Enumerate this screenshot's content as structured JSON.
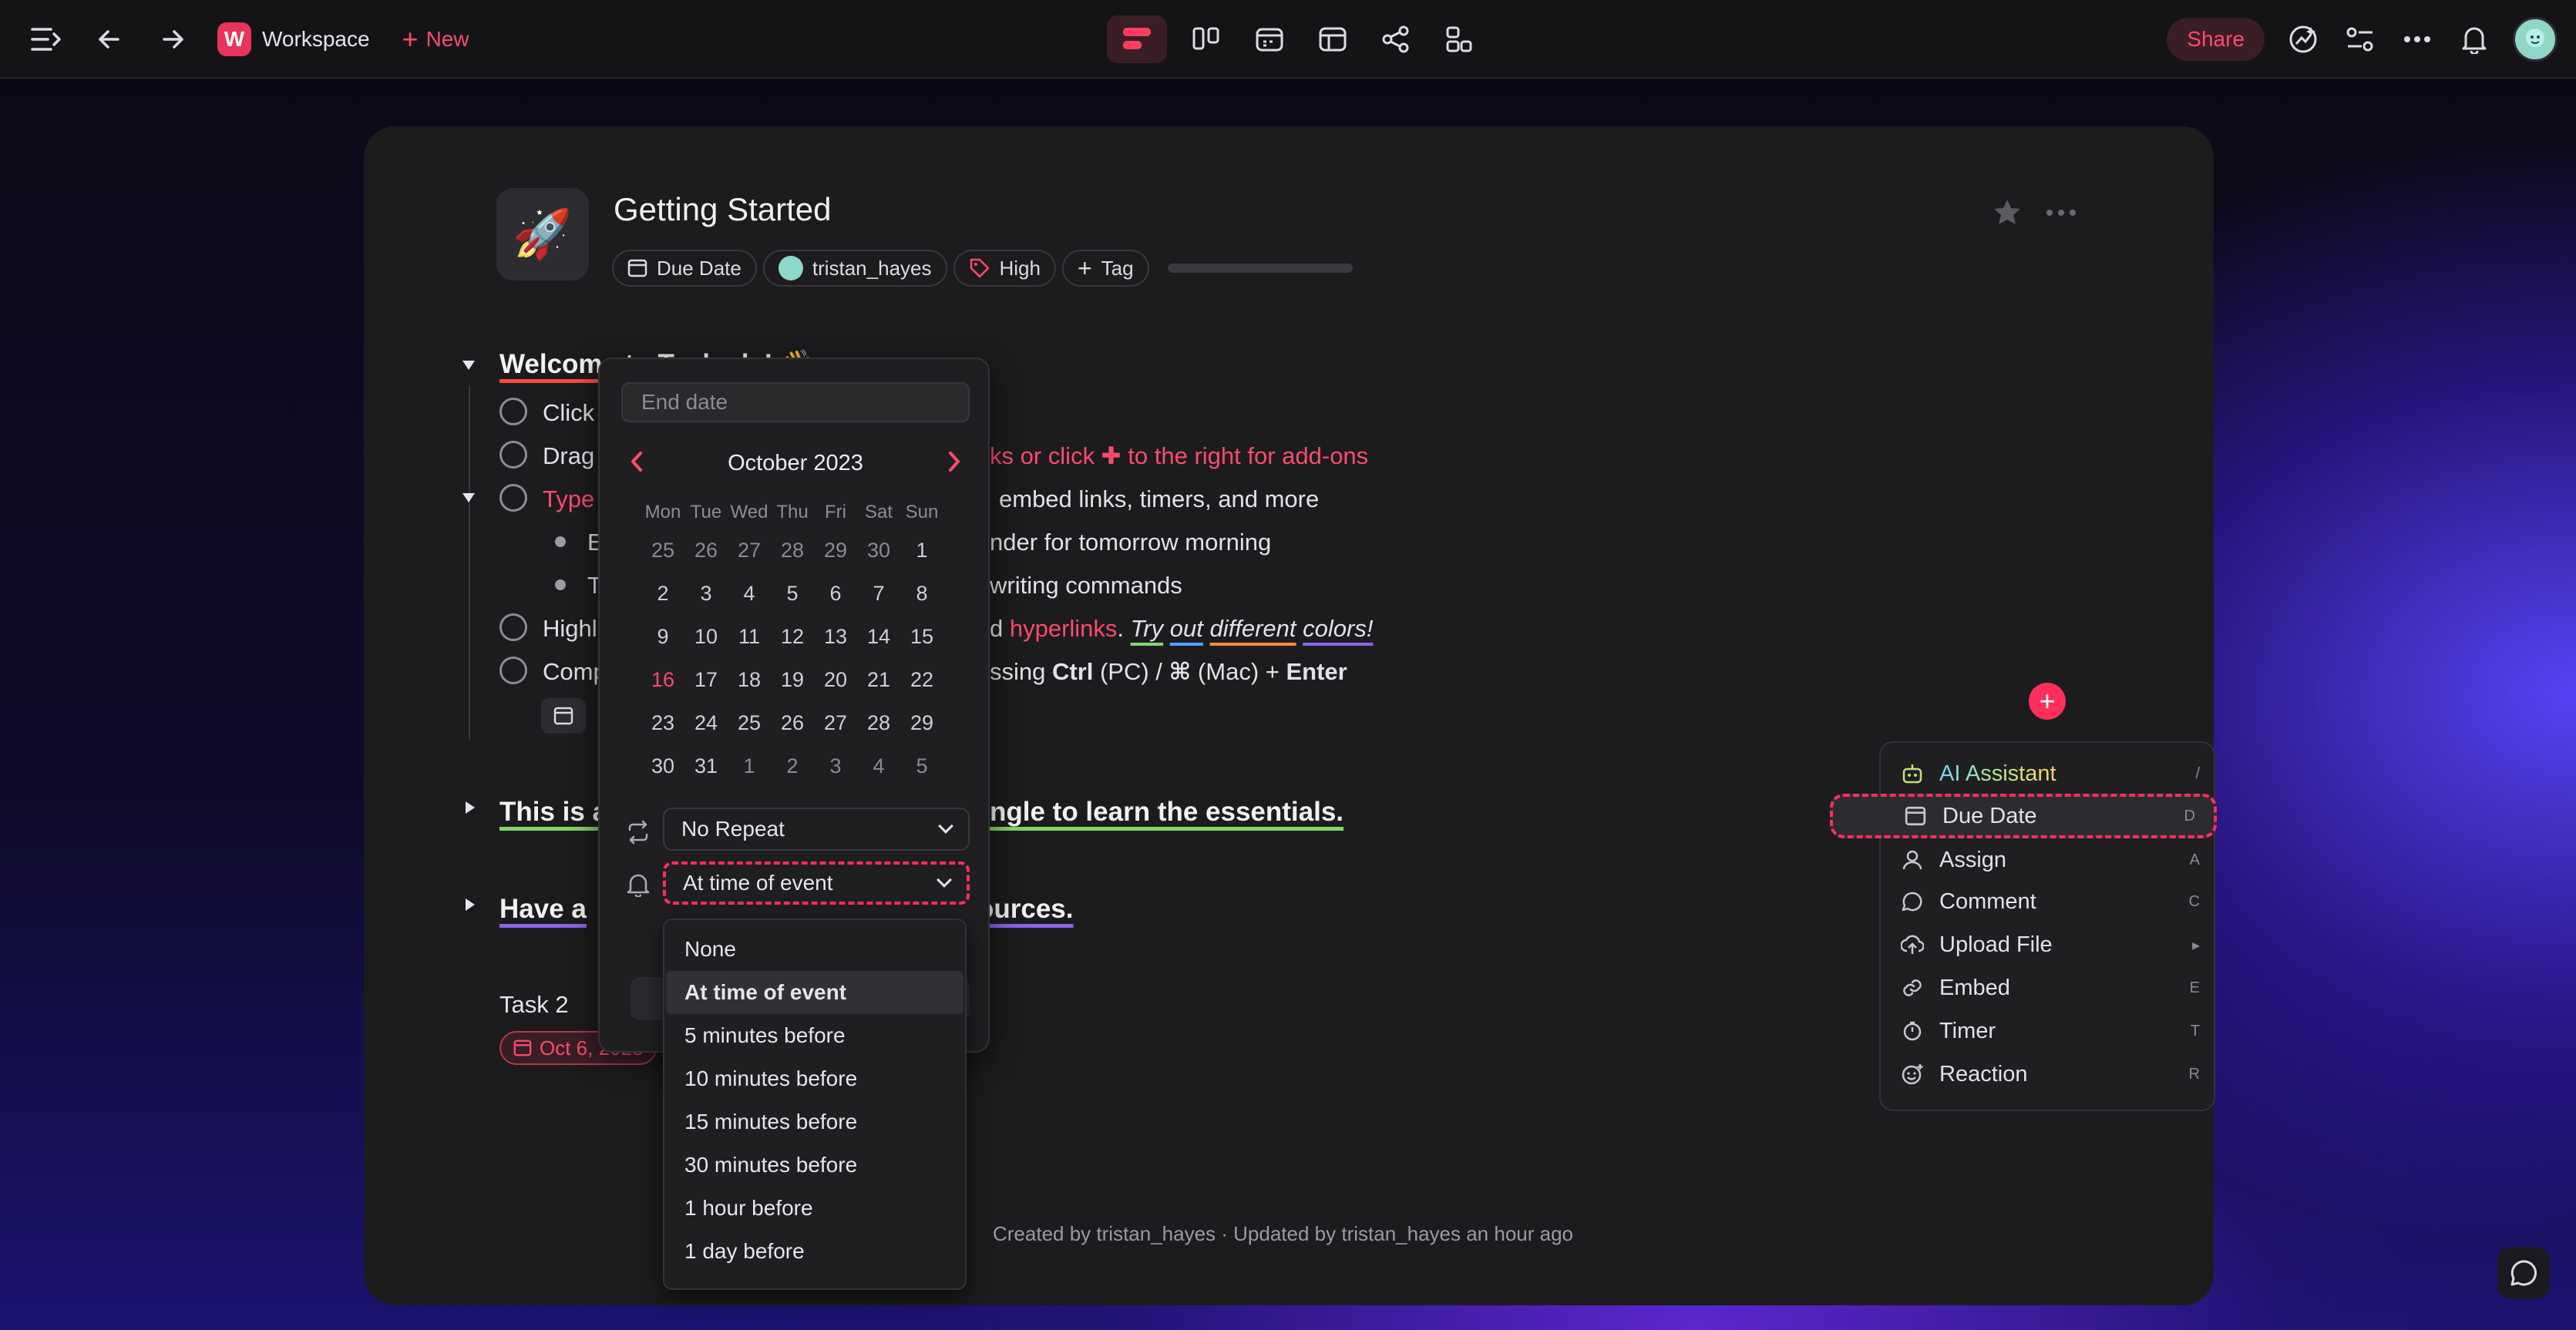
{
  "topbar": {
    "workspace_initial": "W",
    "workspace_name": "Workspace",
    "new_label": "New",
    "share_label": "Share"
  },
  "page": {
    "icon": "🚀",
    "title": "Getting Started",
    "props": {
      "due_date": "Due Date",
      "assignee": "tristan_hayes",
      "priority": "High",
      "tag": "Tag"
    }
  },
  "doc": {
    "heading1_visible": "Welcome to Taskade! 👋",
    "row1_start": "Click",
    "row2_start": "Drag",
    "row2_end": "ks or click ✚ to the right for add-ons",
    "row3_start": "Type",
    "row3_end": "embed links, timers, and more",
    "row4_start": "E",
    "row4_end": "nder for tomorrow morning",
    "row5_start": "T",
    "row5_end": "writing commands",
    "row6_start": "Highl",
    "row6_mid": "d ",
    "row6_link": "hyperlinks",
    "row6_after": ". ",
    "row6_try": "Try",
    "row6_out": "out",
    "row6_different": "different",
    "row6_colors": "colors!",
    "row7_start": "Comp",
    "row7_a": "ssing ",
    "row7_ctrl": "Ctrl",
    "row7_b": " (PC) / ",
    "row7_cmd": "⌘",
    "row7_c": " (Mac) + ",
    "row7_enter": "Enter",
    "heading2_start": "This is a",
    "heading2_end": "ngle to learn the essentials.",
    "heading3_start": "Have a",
    "heading3_end": "ources.",
    "task2": "Task 2",
    "task2_date": "Oct 6, 2023",
    "footer": "Created by tristan_hayes · Updated by tristan_hayes an hour ago"
  },
  "calendar": {
    "end_date_placeholder": "End date",
    "month": "October 2023",
    "dow": [
      "Mon",
      "Tue",
      "Wed",
      "Thu",
      "Fri",
      "Sat",
      "Sun"
    ],
    "weeks": [
      [
        "25",
        "26",
        "27",
        "28",
        "29",
        "30",
        "1"
      ],
      [
        "2",
        "3",
        "4",
        "5",
        "6",
        "7",
        "8"
      ],
      [
        "9",
        "10",
        "11",
        "12",
        "13",
        "14",
        "15"
      ],
      [
        "16",
        "17",
        "18",
        "19",
        "20",
        "21",
        "22"
      ],
      [
        "23",
        "24",
        "25",
        "26",
        "27",
        "28",
        "29"
      ],
      [
        "30",
        "31",
        "1",
        "2",
        "3",
        "4",
        "5"
      ]
    ],
    "today": "16",
    "repeat_value": "No Repeat",
    "reminder_value": "At time of event",
    "reminder_options": [
      "None",
      "At time of event",
      "5 minutes before",
      "10 minutes before",
      "15 minutes before",
      "30 minutes before",
      "1 hour before",
      "1 day before"
    ],
    "reminder_selected_index": 1
  },
  "addon_menu": {
    "items": [
      {
        "label": "AI Assistant",
        "key": "/",
        "icon": "robot-icon"
      },
      {
        "label": "Due Date",
        "key": "D",
        "icon": "calendar-icon"
      },
      {
        "label": "Assign",
        "key": "A",
        "icon": "person-icon"
      },
      {
        "label": "Comment",
        "key": "C",
        "icon": "comment-icon"
      },
      {
        "label": "Upload File",
        "key": "▸",
        "icon": "upload-icon"
      },
      {
        "label": "Embed",
        "key": "E",
        "icon": "link-icon"
      },
      {
        "label": "Timer",
        "key": "T",
        "icon": "timer-icon"
      },
      {
        "label": "Reaction",
        "key": "R",
        "icon": "emoji-icon"
      }
    ]
  },
  "colors": {
    "accent": "#ff2f5c",
    "card_bg": "#1c1c1e",
    "topbar_bg": "#141416"
  }
}
